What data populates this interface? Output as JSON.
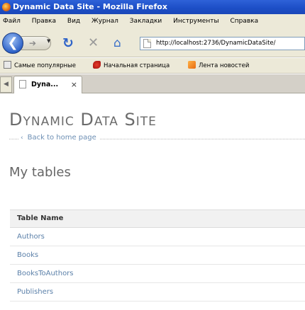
{
  "window": {
    "title": "Dynamic Data Site - Mozilla Firefox"
  },
  "menu": [
    "Файл",
    "Правка",
    "Вид",
    "Журнал",
    "Закладки",
    "Инструменты",
    "Справка"
  ],
  "toolbar": {
    "back_icon": "back-arrow-icon",
    "forward_icon": "forward-arrow-icon",
    "url": "http://localhost:2736/DynamicDataSite/"
  },
  "bookmarks": [
    {
      "label": "Самые популярные",
      "icon": "page-icon"
    },
    {
      "label": "Начальная страница",
      "icon": "firefox-start-icon"
    },
    {
      "label": "Лента новостей",
      "icon": "rss-feed-icon"
    }
  ],
  "tab": {
    "label": "Dyna...",
    "close": "×"
  },
  "page": {
    "site_title": "Dynamic Data Site",
    "back_link": "Back to home page",
    "section_title": "My tables",
    "table": {
      "header": "Table Name",
      "rows": [
        "Authors",
        "Books",
        "BooksToAuthors",
        "Publishers"
      ]
    }
  },
  "colors": {
    "titlebar": "#1d4fc7",
    "chrome": "#ece9d8",
    "link": "#5b80a9",
    "title_text": "#6b6b6b"
  }
}
